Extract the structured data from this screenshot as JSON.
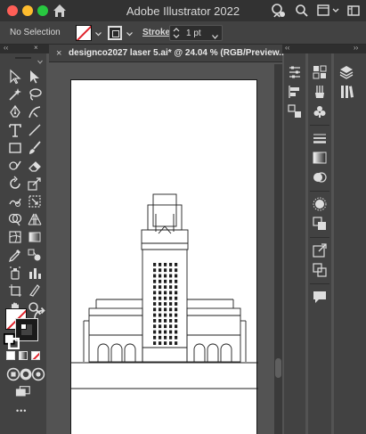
{
  "window": {
    "title": "Adobe Illustrator 2022"
  },
  "control_bar": {
    "selection_label": "No Selection",
    "stroke_label": "Stroke:",
    "stroke_value": "1 pt"
  },
  "document": {
    "tab_title": "designco2027 laser 5.ai* @ 24.04 % (RGB/Preview...",
    "close_glyph": "×"
  },
  "panels": {
    "collapse_glyph": "‹‹",
    "expand_glyph": "››"
  },
  "toolbar": {
    "more_tools_glyph": "•••"
  },
  "colors": {
    "fill": "#ffffff",
    "stroke": "#000000",
    "none_slash": "#e0232b",
    "ui_dark": "#323232",
    "ui_mid": "#424242",
    "canvas_bg": "#535353"
  }
}
